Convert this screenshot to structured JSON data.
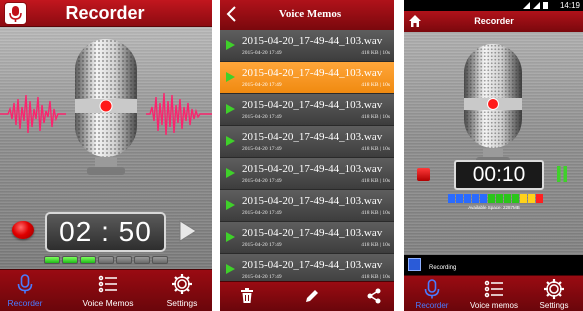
{
  "screen1": {
    "title": "Recorder",
    "timer": "02 : 50",
    "level_meter": [
      1,
      1,
      1,
      0,
      0,
      0,
      0
    ],
    "nav": [
      {
        "label": "Recorder",
        "icon": "microphone-icon",
        "active": true
      },
      {
        "label": "Voice Memos",
        "icon": "list-icon",
        "active": false
      },
      {
        "label": "Settings",
        "icon": "gear-icon",
        "active": false
      }
    ]
  },
  "screen2": {
    "title": "Voice Memos",
    "rows": [
      {
        "name": "2015-04-20_17-49-44_103.wav",
        "date": "2015-04-20 17:49",
        "info": "418 KB | 10s",
        "selected": false
      },
      {
        "name": "2015-04-20_17-49-44_103.wav",
        "date": "2015-04-20 17:49",
        "info": "418 KB | 10s",
        "selected": true
      },
      {
        "name": "2015-04-20_17-49-44_103.wav",
        "date": "2015-04-20 17:49",
        "info": "418 KB | 10s",
        "selected": false
      },
      {
        "name": "2015-04-20_17-49-44_103.wav",
        "date": "2015-04-20 17:49",
        "info": "418 KB | 10s",
        "selected": false
      },
      {
        "name": "2015-04-20_17-49-44_103.wav",
        "date": "2015-04-20 17:49",
        "info": "418 KB | 10s",
        "selected": false
      },
      {
        "name": "2015-04-20_17-49-44_103.wav",
        "date": "2015-04-20 17:49",
        "info": "418 KB | 10s",
        "selected": false
      },
      {
        "name": "2015-04-20_17-49-44_103.wav",
        "date": "2015-04-20 17:49",
        "info": "418 KB | 10s",
        "selected": false
      },
      {
        "name": "2015-04-20_17-49-44_103.wav",
        "date": "2015-04-20 17:49",
        "info": "418 KB | 10s",
        "selected": false
      }
    ],
    "toolbar": [
      "trash-icon",
      "pencil-icon",
      "share-icon"
    ]
  },
  "screen3": {
    "clock": "14:19",
    "title": "Recorder",
    "timer": "00:10",
    "available_space": "Available Space: 2287MB",
    "recording_label": "Recording",
    "bar_colors": [
      "#2a6bff",
      "#2a6bff",
      "#2a6bff",
      "#2a6bff",
      "#2a6bff",
      "#2ac51a",
      "#2ac51a",
      "#2ac51a",
      "#2ac51a",
      "#ffd21a",
      "#ffd21a",
      "#ff2020"
    ],
    "nav": [
      {
        "label": "Recorder",
        "icon": "microphone-icon",
        "active": true
      },
      {
        "label": "Voice memos",
        "icon": "list-icon",
        "active": false
      },
      {
        "label": "Settings",
        "icon": "gear-icon",
        "active": false
      }
    ]
  },
  "colors": {
    "accent_red": "#b0121a",
    "selected_orange": "#f5961f",
    "active_blue": "#4a7bff"
  }
}
